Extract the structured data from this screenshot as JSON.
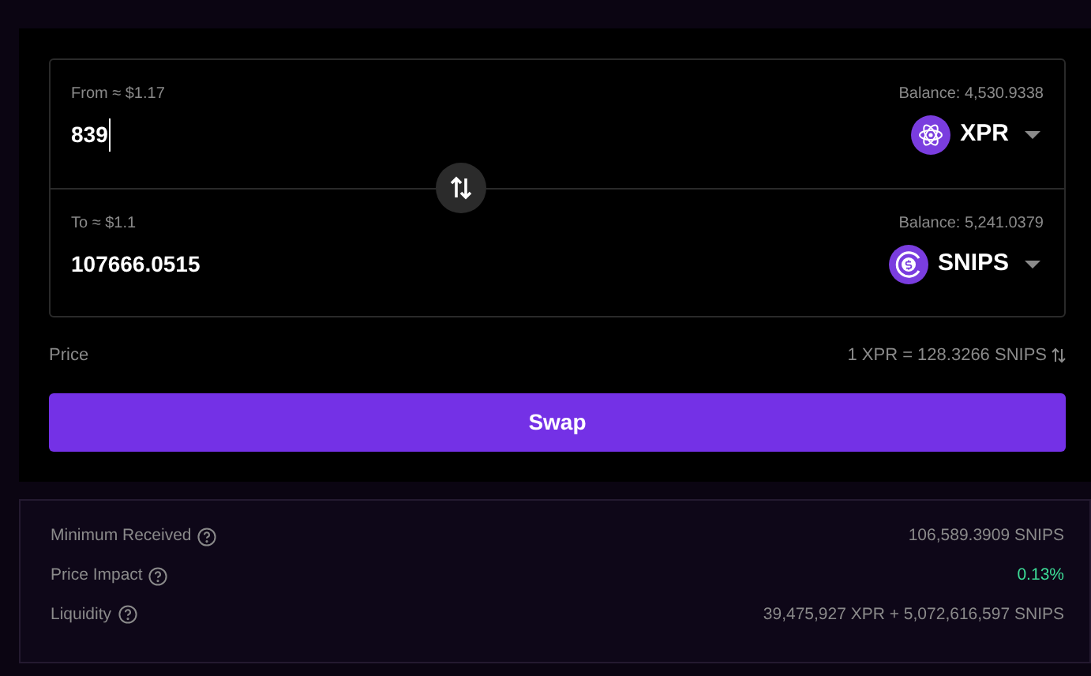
{
  "swap_panel": {
    "legs": [
      {
        "label": "From ≈ $1.17",
        "balance": "Balance: 4,530.9338",
        "amount": "839",
        "focused": true,
        "token": {
          "symbol": "XPR"
        }
      },
      {
        "label": "To ≈ $1.1",
        "balance": "Balance: 5,241.0379",
        "amount": "107666.0515",
        "focused": false,
        "token": {
          "symbol": "SNIPS"
        }
      }
    ]
  },
  "price": {
    "label": "Price",
    "value": "1 XPR = 128.3266 SNIPS"
  },
  "swap_button": "Swap",
  "details": [
    {
      "label": "Minimum Received",
      "value": "106,589.3909 SNIPS",
      "kind": "plain"
    },
    {
      "label": "Price Impact",
      "value": "0.13%",
      "kind": "positive"
    },
    {
      "label": "Liquidity",
      "value": "39,475,927 XPR + 5,072,616,597 SNIPS",
      "kind": "plain"
    }
  ]
}
